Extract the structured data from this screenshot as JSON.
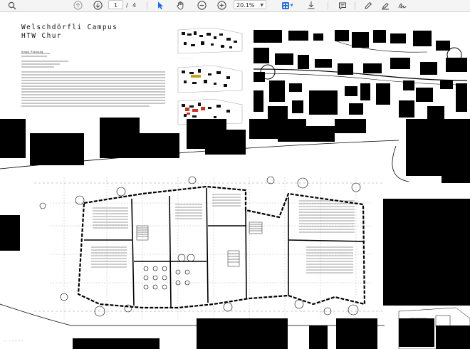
{
  "toolbar": {
    "current_page": "1",
    "page_separator": "/",
    "total_pages": "4",
    "zoom": "20.1%",
    "icons": [
      "search-icon",
      "previous-page-icon",
      "next-page-icon",
      "selection-arrow-icon",
      "hand-tool-icon",
      "zoom-out-icon",
      "zoom-in-icon",
      "fit-page-icon",
      "scroll-mode-icon",
      "comment-icon",
      "pen-icon",
      "highlight-icon",
      "sign-icon"
    ]
  },
  "document": {
    "title_line1": "Welschdörfli Campus",
    "title_line2": "HTW Chur",
    "subtitle": "Urban Planning",
    "colors": {
      "ink": "#000000",
      "paper": "#ffffff",
      "accent": "#2c6fd8",
      "highlight": "#cc3322"
    }
  }
}
